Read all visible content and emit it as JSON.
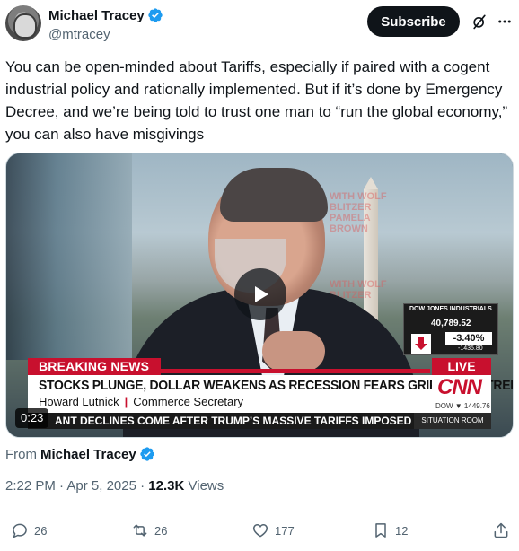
{
  "author": {
    "display_name": "Michael Tracey",
    "handle": "@mtracey",
    "subscribe_label": "Subscribe"
  },
  "tweet": {
    "text": "You can be open-minded about Tariffs, especially if paired with a cogent industrial policy and rationally implemented. But if it’s done by Emergency Decree, and we’re being told to trust one man to “run the global economy,” you can also have misgivings"
  },
  "video": {
    "duration": "0:23",
    "breaking_label": "BREAKING NEWS",
    "live_label": "LIVE",
    "headline": "STOCKS PLUNGE, DOLLAR WEAKENS AS RECESSION FEARS GRIP WALL STREET",
    "guest_name": "Howard Lutnick",
    "guest_title": "Commerce Secretary",
    "network": "CNN",
    "ticker": "ANT DECLINES COME AFTER TRUMP’S MASSIVE TARIFFS IMPOSED ON PRACTIC",
    "show": "SITUATION ROOM",
    "overlay_top": "WITH WOLF BLITZER PAMELA BROWN",
    "overlay_mid": "WITH WOLF BLITZER",
    "dow": {
      "title": "DOW JONES INDUSTRIALS",
      "value": "40,789.52",
      "percent": "-3.40%",
      "change": "-1435.80",
      "small": "DOW ▼ 1449.76"
    }
  },
  "from": {
    "label": "From",
    "name": "Michael Tracey"
  },
  "meta": {
    "time": "2:22 PM",
    "sep": "·",
    "date": "Apr 5, 2025",
    "views_count": "12.3K",
    "views_label": "Views"
  },
  "actions": {
    "replies": "26",
    "reposts": "26",
    "likes": "177",
    "bookmarks": "12"
  },
  "colors": {
    "verified": "#1d9bf0",
    "cnn_red": "#c8102e",
    "secondary_text": "#536471"
  }
}
